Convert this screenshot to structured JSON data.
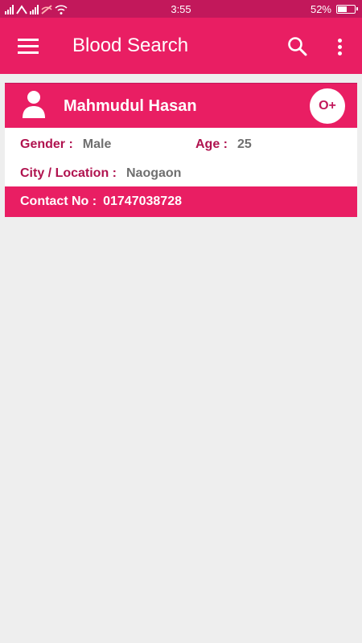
{
  "status_bar": {
    "time": "3:55",
    "battery": "52%",
    "battery_level": 0.52
  },
  "app_bar": {
    "title": "Blood Search",
    "icons": [
      "menu-icon",
      "search-icon",
      "more-vert-icon"
    ]
  },
  "donor": {
    "name": "Mahmudul Hasan",
    "blood_group": "O+",
    "gender_label": "Gender :",
    "gender": "Male",
    "age_label": "Age :",
    "age": "25",
    "city_label": "City / Location :",
    "city": "Naogaon",
    "contact_label": "Contact No :",
    "contact": "01747038728"
  },
  "colors": {
    "status_bar": "#c2185b",
    "primary": "#e91e63",
    "label": "#b0134f",
    "value": "#6f6f6f",
    "background": "#eeeeee"
  }
}
